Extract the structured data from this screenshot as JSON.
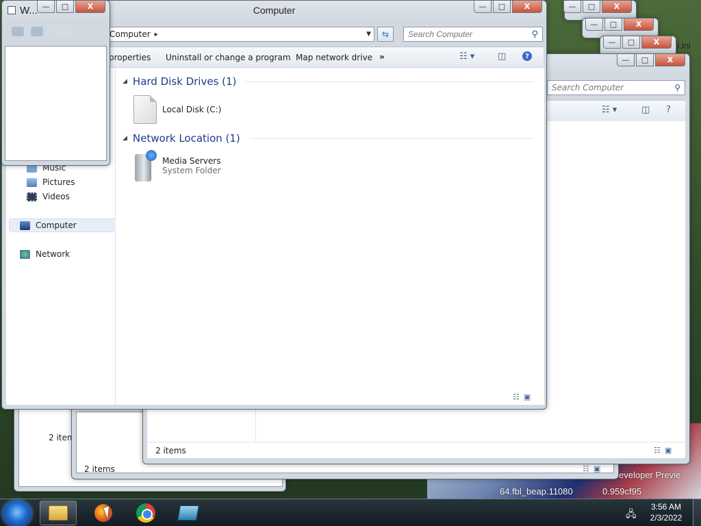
{
  "desktop": {
    "text1": "eveloper Previe",
    "text2": "64.fbl_beap.11080",
    "text3": "0.959cf95",
    "text4": "p.ini"
  },
  "background_windows": [
    {
      "status": "2 items"
    },
    {
      "status": "2 items"
    },
    {
      "status": "2 items"
    },
    {
      "search_placeholder": "Search Computer"
    }
  ],
  "main_window": {
    "title": "Computer",
    "caption": {
      "minimize": "—",
      "maximize": "□",
      "close": "X"
    },
    "address": {
      "breadcrumb": "Computer",
      "separator": "▸"
    },
    "search_placeholder": "Search Computer",
    "toolbar": {
      "properties": "properties",
      "uninstall": "Uninstall or change a program",
      "map_drive": "Map network drive",
      "more": "»"
    },
    "nav": {
      "music": "Music",
      "pictures": "Pictures",
      "videos": "Videos",
      "computer": "Computer",
      "network": "Network"
    },
    "groups": {
      "hard_disks": {
        "heading": "Hard Disk Drives (1)",
        "items": [
          {
            "name": "Local Disk (C:)"
          }
        ]
      },
      "network_location": {
        "heading": "Network Location (1)",
        "items": [
          {
            "name": "Media Servers",
            "type": "System Folder"
          }
        ]
      }
    }
  },
  "small_window": {
    "title": "W..."
  },
  "taskbar": {
    "clock_time": "3:56 AM",
    "clock_date": "2/3/2022"
  },
  "icons": {
    "search": "search-icon",
    "refresh": "refresh-icon",
    "views": "change-view-icon",
    "preview_pane": "preview-pane-icon",
    "help": "help-icon"
  },
  "colors": {
    "group_heading": "#1e3a8a",
    "close_button": "#c5543e",
    "nav_selected": "#e7eef8"
  }
}
